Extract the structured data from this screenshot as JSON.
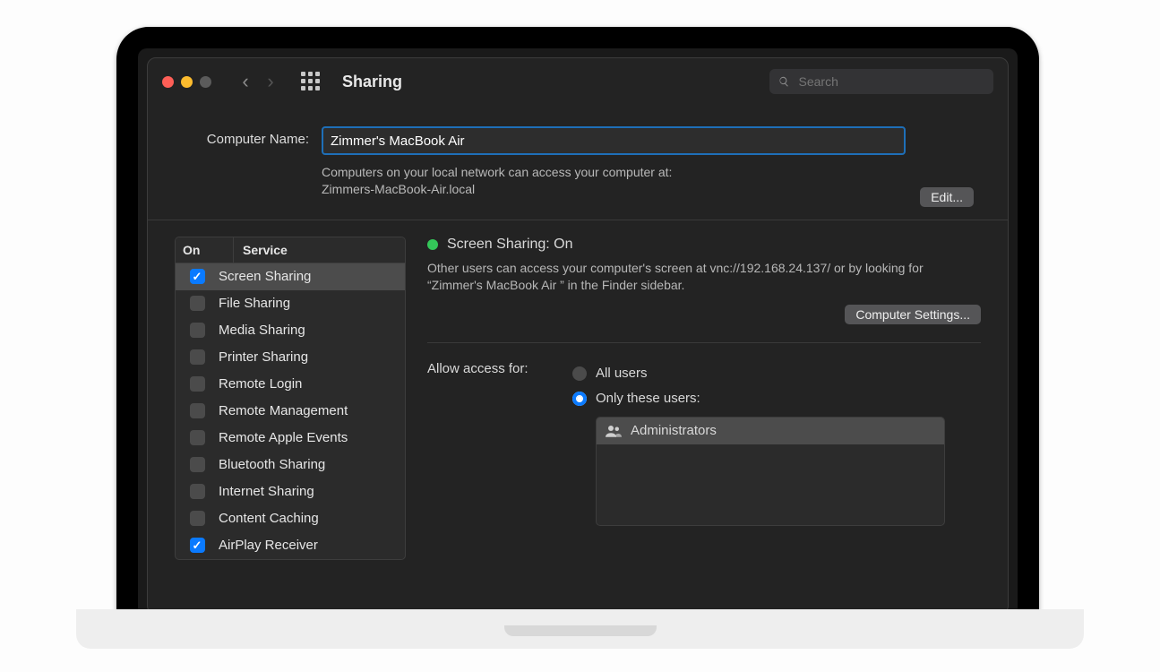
{
  "toolbar": {
    "title": "Sharing",
    "search_placeholder": "Search"
  },
  "computer_name": {
    "label": "Computer Name:",
    "value": "Zimmer's MacBook Air",
    "desc_line1": "Computers on your local network can access your computer at:",
    "desc_line2": "Zimmers-MacBook-Air.local",
    "edit_label": "Edit..."
  },
  "services": {
    "header_on": "On",
    "header_service": "Service",
    "items": [
      {
        "label": "Screen Sharing",
        "checked": true,
        "selected": true
      },
      {
        "label": "File Sharing",
        "checked": false
      },
      {
        "label": "Media Sharing",
        "checked": false
      },
      {
        "label": "Printer Sharing",
        "checked": false
      },
      {
        "label": "Remote Login",
        "checked": false
      },
      {
        "label": "Remote Management",
        "checked": false
      },
      {
        "label": "Remote Apple Events",
        "checked": false
      },
      {
        "label": "Bluetooth Sharing",
        "checked": false
      },
      {
        "label": "Internet Sharing",
        "checked": false
      },
      {
        "label": "Content Caching",
        "checked": false
      },
      {
        "label": "AirPlay Receiver",
        "checked": true
      }
    ]
  },
  "detail": {
    "status_label": "Screen Sharing: On",
    "status_color": "#34c759",
    "description": "Other users can access your computer's screen at vnc://192.168.24.137/ or by looking for “Zimmer's MacBook Air ” in the Finder sidebar.",
    "settings_button": "Computer Settings...",
    "access_label": "Allow access for:",
    "radio_all": "All users",
    "radio_only": "Only these users:",
    "selected_radio": "only",
    "users": [
      {
        "label": "Administrators"
      }
    ]
  }
}
